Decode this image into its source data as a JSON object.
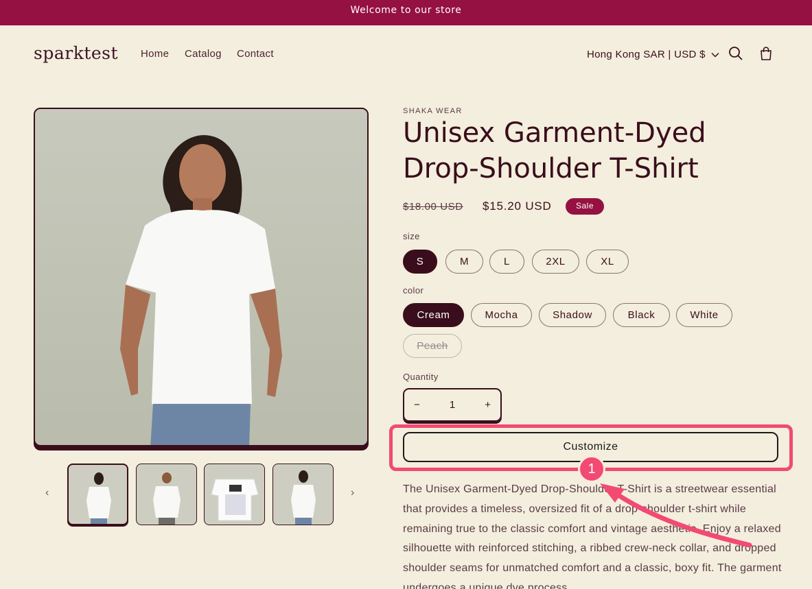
{
  "announcement": "Welcome to our store",
  "header": {
    "logo": "sparktest",
    "nav": [
      "Home",
      "Catalog",
      "Contact"
    ],
    "locale": "Hong Kong SAR | USD $",
    "icons": [
      "search-icon",
      "cart-icon"
    ]
  },
  "product": {
    "vendor": "SHAKA WEAR",
    "title": "Unisex Garment-Dyed Drop-Shoulder T-Shirt",
    "price_original": "$18.00 USD",
    "price_sale": "$15.20 USD",
    "sale_badge": "Sale",
    "size_label": "size",
    "sizes": [
      "S",
      "M",
      "L",
      "2XL",
      "XL"
    ],
    "selected_size": "S",
    "color_label": "color",
    "colors": [
      "Cream",
      "Mocha",
      "Shadow",
      "Black",
      "White",
      "Peach"
    ],
    "selected_color": "Cream",
    "unavailable_color": "Peach",
    "quantity_label": "Quantity",
    "quantity": "1",
    "qty_minus": "−",
    "qty_plus": "+",
    "customize_label": "Customize",
    "description": "The Unisex Garment-Dyed Drop-Shoulder T-Shirt is a streetwear essential that provides a timeless, oversized fit of a drop-shoulder t-shirt while remaining true to the classic comfort and vintage aesthetic. Enjoy a relaxed silhouette with reinforced stitching, a ribbed crew-neck collar, and dropped shoulder seams for unmatched comfort and a classic, boxy fit. The garment undergoes a unique dye process"
  },
  "annotation": {
    "badge": "1"
  },
  "gallery": {
    "prev_icon": "chevron-left-icon",
    "next_icon": "chevron-right-icon",
    "thumbnails": 4
  },
  "colors": {
    "brand": "#951142",
    "ink": "#3a0d1c",
    "background": "#f3eedd",
    "highlight": "#f24a72"
  }
}
